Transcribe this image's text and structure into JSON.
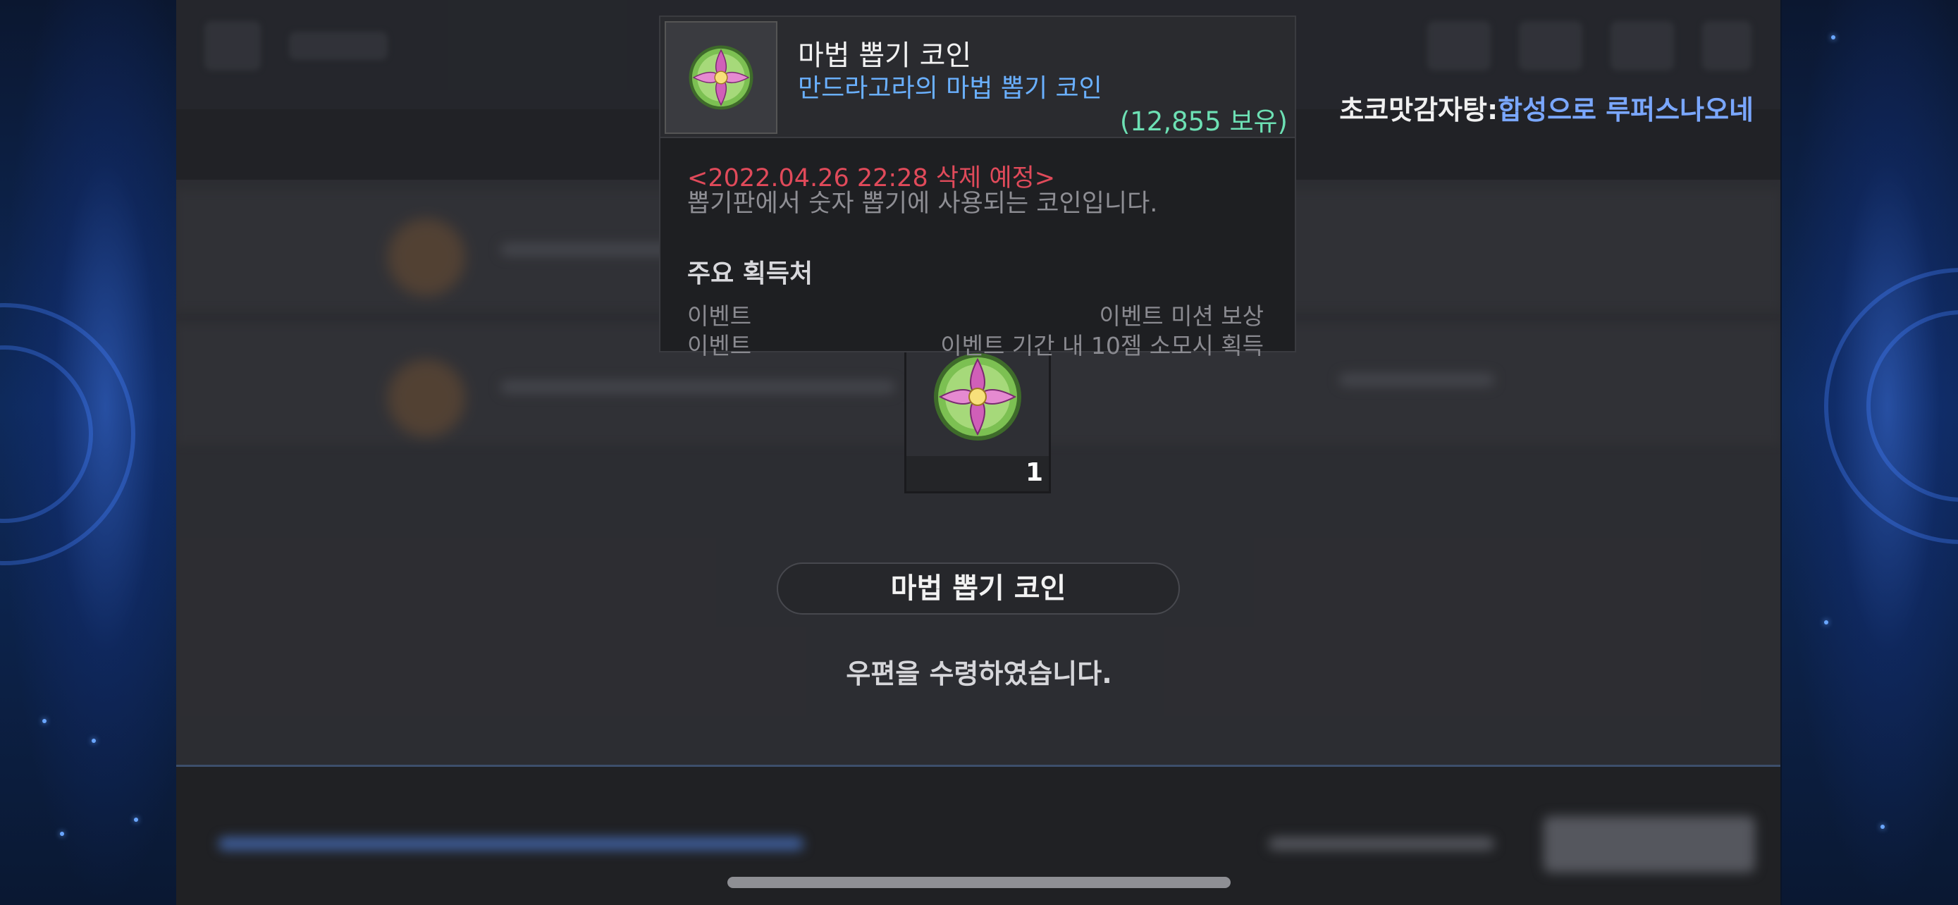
{
  "banner": {
    "name": "초코맛감자탕",
    "separator": ":",
    "message": "합성으로 루퍼스나오네"
  },
  "tooltip": {
    "item_name": "마법 뽑기 코인",
    "item_subtitle": "만드라고라의 마법 뽑기 코인",
    "owned_count": "(12,855 보유)",
    "expire_text": "<2022.04.26 22:28 삭제 예정>",
    "description": "뽑기판에서 숫자 뽑기에 사용되는 코인입니다.",
    "sources_title": "주요 획득처",
    "sources": [
      {
        "type": "이벤트",
        "detail": "이벤트 미션 보상"
      },
      {
        "type": "이벤트",
        "detail": "이벤트 기간 내 10젬 소모시 획득"
      }
    ]
  },
  "reward": {
    "quantity": "1",
    "item_name": "마법 뽑기 코인",
    "message": "우편을 수령하였습니다."
  },
  "icons": {
    "item": "mandragora-coin-icon"
  },
  "colors": {
    "expire": "#e04a5a",
    "subtitle": "#6ab0ff",
    "owned": "#6de0b4",
    "banner_highlight": "#7aa7ff"
  }
}
